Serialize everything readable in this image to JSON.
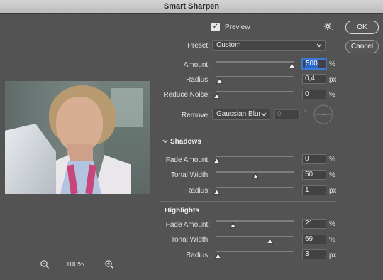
{
  "window": {
    "title": "Smart Sharpen"
  },
  "preview_panel": {
    "zoom_level": "100%"
  },
  "header": {
    "preview_label": "Preview",
    "preview_checked": true
  },
  "buttons": {
    "ok": "OK",
    "cancel": "Cancel"
  },
  "preset": {
    "label": "Preset:",
    "value": "Custom"
  },
  "main": {
    "amount": {
      "label": "Amount:",
      "value": "500",
      "unit": "%",
      "level": 0.97
    },
    "radius": {
      "label": "Radius:",
      "value": "0,4",
      "unit": "px",
      "level": 0.04
    },
    "reduce_noise": {
      "label": "Reduce Noise:",
      "value": "0",
      "unit": "%",
      "level": 0.0
    },
    "remove": {
      "label": "Remove:",
      "value": "Gaussian Blur",
      "angle_value": "0",
      "angle_unit": "°"
    }
  },
  "shadows": {
    "title": "Shadows",
    "fade_amount": {
      "label": "Fade Amount:",
      "value": "0",
      "unit": "%",
      "level": 0.0
    },
    "tonal_width": {
      "label": "Tonal Width:",
      "value": "50",
      "unit": "%",
      "level": 0.5
    },
    "radius": {
      "label": "Radius:",
      "value": "1",
      "unit": "px",
      "level": 0.0
    }
  },
  "highlights": {
    "title": "Highlights",
    "fade_amount": {
      "label": "Fade Amount:",
      "value": "21",
      "unit": "%",
      "level": 0.21
    },
    "tonal_width": {
      "label": "Tonal Width:",
      "value": "69",
      "unit": "%",
      "level": 0.69
    },
    "radius": {
      "label": "Radius:",
      "value": "3",
      "unit": "px",
      "level": 0.02
    }
  },
  "colors": {
    "focus": "#3d78d8",
    "background": "#535353",
    "title_bar": "#c8c8c8"
  }
}
